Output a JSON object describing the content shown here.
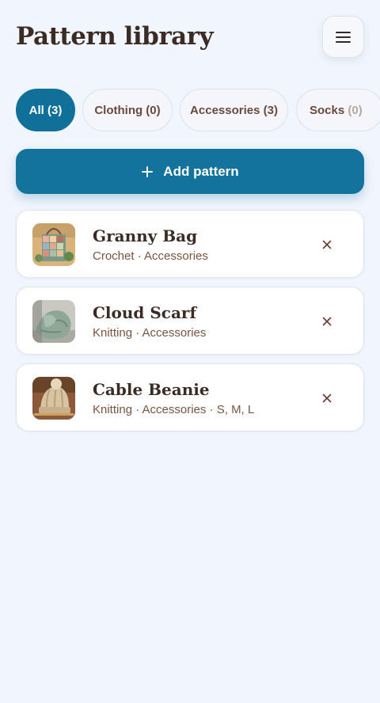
{
  "header": {
    "title": "Pattern library",
    "menu_icon": "hamburger-menu-icon"
  },
  "tabs": [
    {
      "label": "All (3)",
      "active": true
    },
    {
      "label": "Clothing (0)",
      "active": false
    },
    {
      "label": "Accessories (3)",
      "active": false
    },
    {
      "label": "Socks (0)",
      "name": "Socks",
      "count": "(0)",
      "active": false
    }
  ],
  "add_button": {
    "label": "Add pattern",
    "icon": "plus-icon"
  },
  "patterns": [
    {
      "title": "Granny Bag",
      "meta": "Crochet · Accessories",
      "image": "granny-bag-photo"
    },
    {
      "title": "Cloud Scarf",
      "meta": "Knitting · Accessories",
      "image": "cloud-scarf-photo"
    },
    {
      "title": "Cable Beanie",
      "meta": "Knitting · Accessories · S, M, L",
      "image": "cable-beanie-photo"
    }
  ],
  "colors": {
    "background": "#f1f5fd",
    "accent": "#13739d",
    "title_text": "#3b2b25",
    "meta_text": "#7a5440",
    "card": "#ffffff"
  }
}
